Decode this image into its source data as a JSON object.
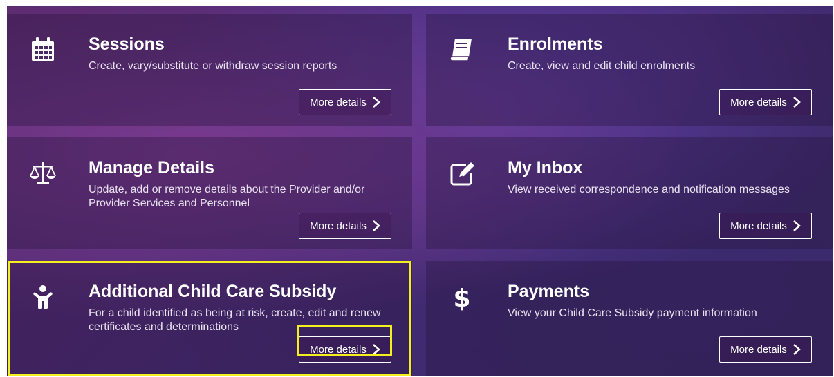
{
  "tiles": [
    {
      "title": "Sessions",
      "description": "Create, vary/substitute or withdraw session reports",
      "button": "More details",
      "icon": "calendar-icon"
    },
    {
      "title": "Enrolments",
      "description": "Create, view and edit child enrolments",
      "button": "More details",
      "icon": "book-icon"
    },
    {
      "title": "Manage Details",
      "description": "Update, add or remove details about the Provider and/or Provider Services and Personnel",
      "button": "More details",
      "icon": "scales-icon"
    },
    {
      "title": "My Inbox",
      "description": "View received correspondence and notification messages",
      "button": "More details",
      "icon": "edit-icon"
    },
    {
      "title": "Additional Child Care Subsidy",
      "description": "For a child identified as being at risk, create, edit and renew certificates and determinations",
      "button": "More details",
      "icon": "child-icon"
    },
    {
      "title": "Payments",
      "description": "View your Child Care Subsidy payment information",
      "button": "More details",
      "icon": "dollar-icon"
    }
  ],
  "colors": {
    "highlight": "#f4f01e",
    "tile_text": "#ffffff",
    "background": "#4a2c78"
  }
}
